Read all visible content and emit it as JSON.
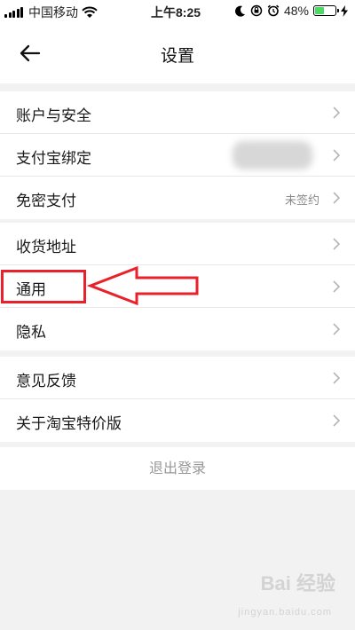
{
  "status_bar": {
    "carrier": "中国移动",
    "time": "上午8:25",
    "battery_pct": "48%",
    "battery_level": 0.48,
    "icons": [
      "signal-icon",
      "wifi-icon",
      "moon-icon",
      "rotation-lock-icon",
      "alarm-icon",
      "battery-icon",
      "charging-icon"
    ]
  },
  "nav": {
    "title": "设置",
    "back_icon": "back-arrow-icon"
  },
  "groups": [
    {
      "items": [
        {
          "label": "账户与安全",
          "value": ""
        },
        {
          "label": "支付宝绑定",
          "value": ""
        },
        {
          "label": "免密支付",
          "value": "未签约"
        }
      ]
    },
    {
      "items": [
        {
          "label": "收货地址",
          "value": ""
        },
        {
          "label": "通用",
          "value": ""
        },
        {
          "label": "隐私",
          "value": ""
        }
      ]
    },
    {
      "items": [
        {
          "label": "意见反馈",
          "value": ""
        },
        {
          "label": "关于淘宝特价版",
          "value": ""
        }
      ]
    }
  ],
  "logout": {
    "label": "退出登录"
  },
  "annotation": {
    "highlight_color": "#e8212b"
  },
  "watermark": {
    "main": "Bai 经验",
    "sub": "jingyan.baidu.com"
  }
}
